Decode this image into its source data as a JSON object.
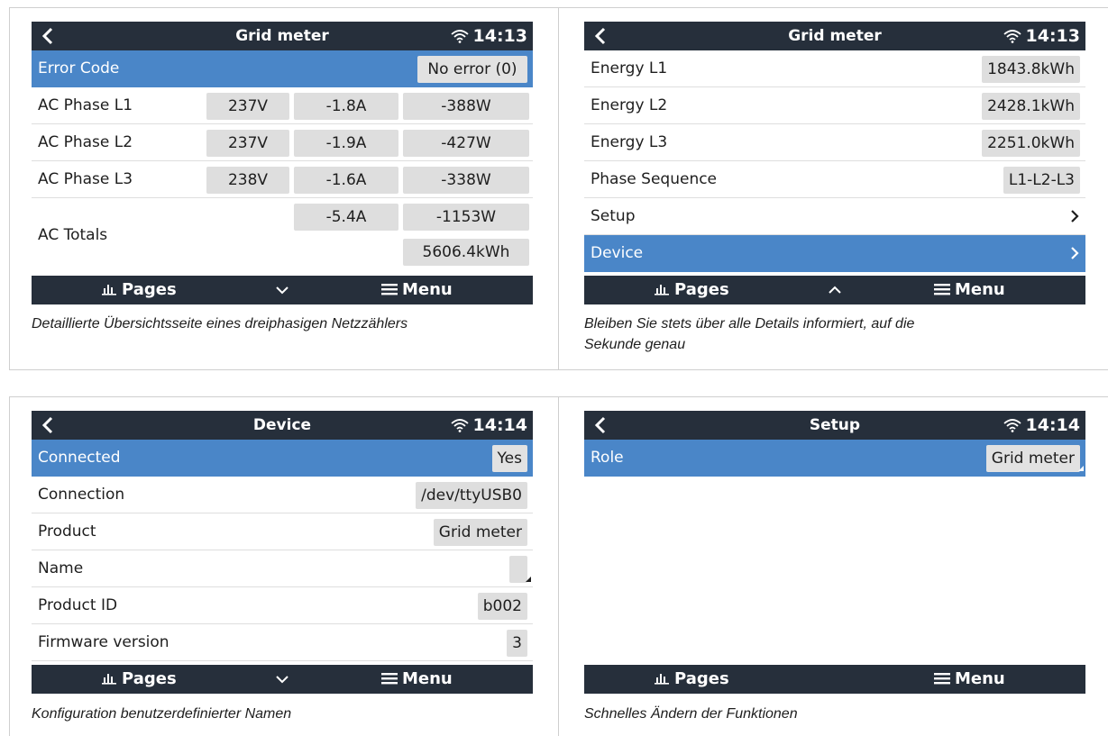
{
  "panels": {
    "p1": {
      "header": {
        "title": "Grid meter",
        "time": "14:13"
      },
      "error": {
        "label": "Error Code",
        "value": "No error (0)"
      },
      "phases": [
        {
          "label": "AC Phase L1",
          "v": "237V",
          "a": "-1.8A",
          "w": "-388W"
        },
        {
          "label": "AC Phase L2",
          "v": "237V",
          "a": "-1.9A",
          "w": "-427W"
        },
        {
          "label": "AC Phase L3",
          "v": "238V",
          "a": "-1.6A",
          "w": "-338W"
        }
      ],
      "totals": {
        "label": "AC Totals",
        "a": "-5.4A",
        "w": "-1153W",
        "kwh": "5606.4kWh"
      },
      "footer": {
        "pages": "Pages",
        "menu": "Menu"
      },
      "caption": "Detaillierte Übersichtsseite eines dreiphasigen Netzzählers"
    },
    "p2": {
      "header": {
        "title": "Grid meter",
        "time": "14:13"
      },
      "rows": [
        {
          "label": "Energy L1",
          "value": "1843.8kWh"
        },
        {
          "label": "Energy L2",
          "value": "2428.1kWh"
        },
        {
          "label": "Energy L3",
          "value": "2251.0kWh"
        },
        {
          "label": "Phase Sequence",
          "value": "L1-L2-L3"
        },
        {
          "label": "Setup"
        },
        {
          "label": "Device"
        }
      ],
      "footer": {
        "pages": "Pages",
        "menu": "Menu"
      },
      "caption_line1": "Bleiben Sie stets über alle Details informiert, auf die",
      "caption_line2": "Sekunde genau"
    },
    "p3": {
      "header": {
        "title": "Device",
        "time": "14:14"
      },
      "rows": [
        {
          "label": "Connected",
          "value": "Yes"
        },
        {
          "label": "Connection",
          "value": "/dev/ttyUSB0"
        },
        {
          "label": "Product",
          "value": "Grid meter"
        },
        {
          "label": "Name",
          "value": ""
        },
        {
          "label": "Product ID",
          "value": "b002"
        },
        {
          "label": "Firmware version",
          "value": "3"
        }
      ],
      "footer": {
        "pages": "Pages",
        "menu": "Menu"
      },
      "caption": "Konfiguration benutzerdefinierter Namen"
    },
    "p4": {
      "header": {
        "title": "Setup",
        "time": "14:14"
      },
      "rows": [
        {
          "label": "Role",
          "value": "Grid meter"
        }
      ],
      "footer": {
        "pages": "Pages",
        "menu": "Menu"
      },
      "caption": "Schnelles Ändern der Funktionen"
    }
  },
  "colors": {
    "header": "#262f3b",
    "selected": "#4a86c8",
    "value_box": "#dedede"
  },
  "icons": [
    "back-arrow-icon",
    "wifi-icon",
    "bar-chart-icon",
    "chevron-down-icon",
    "chevron-up-icon",
    "hamburger-menu-icon",
    "chevron-right-icon"
  ]
}
